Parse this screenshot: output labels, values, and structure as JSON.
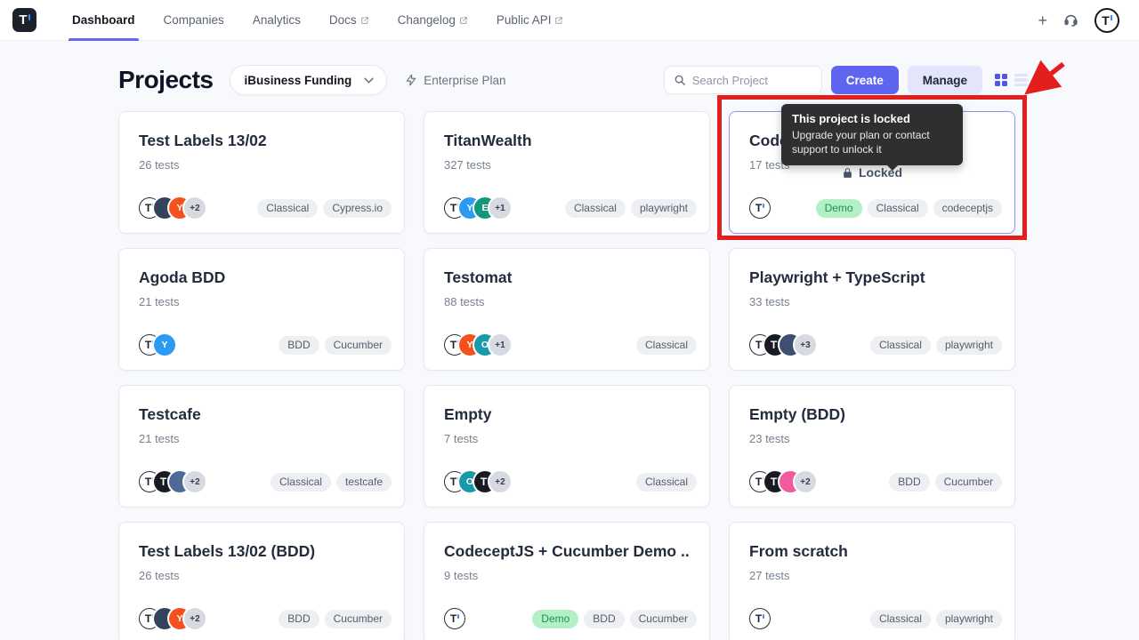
{
  "nav": {
    "items": [
      {
        "label": "Dashboard",
        "active": true,
        "external": false
      },
      {
        "label": "Companies",
        "active": false,
        "external": false
      },
      {
        "label": "Analytics",
        "active": false,
        "external": false
      },
      {
        "label": "Docs",
        "active": false,
        "external": true
      },
      {
        "label": "Changelog",
        "active": false,
        "external": true
      },
      {
        "label": "Public API",
        "active": false,
        "external": true
      }
    ],
    "plus_label": "+"
  },
  "header": {
    "title": "Projects",
    "company_selector": "iBusiness Funding",
    "plan": "Enterprise Plan",
    "search_placeholder": "Search Project",
    "create_label": "Create",
    "manage_label": "Manage"
  },
  "tooltip": {
    "title": "This project is locked",
    "body": "Upgrade your plan or contact support to unlock it"
  },
  "locked_label": "Locked",
  "colors": {
    "accent": "#6065f0",
    "locked_border": "#8b93f8",
    "annotation_red": "#e41d1d",
    "demo_tag_bg": "#b4f0c5",
    "demo_tag_text": "#1d9150"
  },
  "projects": [
    {
      "name": "Test Labels 13/02",
      "tests": "26 tests",
      "locked": false,
      "avatars": [
        {
          "type": "logo"
        },
        {
          "type": "img",
          "color": "#35425e"
        },
        {
          "type": "letter",
          "letter": "Y",
          "color": "#f4511e"
        }
      ],
      "more": "+2",
      "tags": [
        {
          "label": "Classical",
          "style": "gray"
        },
        {
          "label": "Cypress.io",
          "style": "gray"
        }
      ]
    },
    {
      "name": "TitanWealth",
      "tests": "327 tests",
      "locked": false,
      "avatars": [
        {
          "type": "logo"
        },
        {
          "type": "letter",
          "letter": "Y",
          "color": "#2b9af3"
        },
        {
          "type": "letter",
          "letter": "E",
          "color": "#12967d"
        }
      ],
      "more": "+1",
      "tags": [
        {
          "label": "Classical",
          "style": "gray"
        },
        {
          "label": "playwright",
          "style": "gray"
        }
      ]
    },
    {
      "name": "Code",
      "tests": "17 tests",
      "locked": true,
      "avatars": [
        {
          "type": "logo"
        }
      ],
      "more": null,
      "tags": [
        {
          "label": "Demo",
          "style": "green"
        },
        {
          "label": "Classical",
          "style": "gray"
        },
        {
          "label": "codeceptjs",
          "style": "gray"
        }
      ]
    },
    {
      "name": "Agoda BDD",
      "tests": "21 tests",
      "locked": false,
      "avatars": [
        {
          "type": "logo"
        },
        {
          "type": "letter",
          "letter": "Y",
          "color": "#2b9af3"
        }
      ],
      "more": null,
      "tags": [
        {
          "label": "BDD",
          "style": "gray"
        },
        {
          "label": "Cucumber",
          "style": "gray"
        }
      ]
    },
    {
      "name": "Testomat",
      "tests": "88 tests",
      "locked": false,
      "avatars": [
        {
          "type": "logo"
        },
        {
          "type": "letter",
          "letter": "Y",
          "color": "#f4511e"
        },
        {
          "type": "letter",
          "letter": "O",
          "color": "#1a9aa8"
        }
      ],
      "more": "+1",
      "tags": [
        {
          "label": "Classical",
          "style": "gray"
        }
      ]
    },
    {
      "name": "Playwright + TypeScript",
      "tests": "33 tests",
      "locked": false,
      "avatars": [
        {
          "type": "logo"
        },
        {
          "type": "dark"
        },
        {
          "type": "img",
          "color": "#3e4f73"
        }
      ],
      "more": "+3",
      "tags": [
        {
          "label": "Classical",
          "style": "gray"
        },
        {
          "label": "playwright",
          "style": "gray"
        }
      ]
    },
    {
      "name": "Testcafe",
      "tests": "21 tests",
      "locked": false,
      "avatars": [
        {
          "type": "logo"
        },
        {
          "type": "dark"
        },
        {
          "type": "img",
          "color": "#4e6a96"
        }
      ],
      "more": "+2",
      "tags": [
        {
          "label": "Classical",
          "style": "gray"
        },
        {
          "label": "testcafe",
          "style": "gray"
        }
      ]
    },
    {
      "name": "Empty",
      "tests": "7 tests",
      "locked": false,
      "avatars": [
        {
          "type": "logo"
        },
        {
          "type": "letter",
          "letter": "O",
          "color": "#1a9aa8"
        },
        {
          "type": "dark"
        }
      ],
      "more": "+2",
      "tags": [
        {
          "label": "Classical",
          "style": "gray"
        }
      ]
    },
    {
      "name": "Empty (BDD)",
      "tests": "23 tests",
      "locked": false,
      "avatars": [
        {
          "type": "logo"
        },
        {
          "type": "dark"
        },
        {
          "type": "img",
          "color": "#ef5b9c"
        }
      ],
      "more": "+2",
      "tags": [
        {
          "label": "BDD",
          "style": "gray"
        },
        {
          "label": "Cucumber",
          "style": "gray"
        }
      ]
    },
    {
      "name": "Test Labels 13/02 (BDD)",
      "tests": "26 tests",
      "locked": false,
      "avatars": [
        {
          "type": "logo"
        },
        {
          "type": "img",
          "color": "#35425e"
        },
        {
          "type": "letter",
          "letter": "Y",
          "color": "#f4511e"
        }
      ],
      "more": "+2",
      "tags": [
        {
          "label": "BDD",
          "style": "gray"
        },
        {
          "label": "Cucumber",
          "style": "gray"
        }
      ]
    },
    {
      "name": "CodeceptJS + Cucumber Demo ...",
      "tests": "9 tests",
      "locked": false,
      "avatars": [
        {
          "type": "logo"
        }
      ],
      "more": null,
      "tags": [
        {
          "label": "Demo",
          "style": "green"
        },
        {
          "label": "BDD",
          "style": "gray"
        },
        {
          "label": "Cucumber",
          "style": "gray"
        }
      ]
    },
    {
      "name": "From scratch",
      "tests": "27 tests",
      "locked": false,
      "avatars": [
        {
          "type": "logo"
        }
      ],
      "more": null,
      "tags": [
        {
          "label": "Classical",
          "style": "gray"
        },
        {
          "label": "playwright",
          "style": "gray"
        }
      ]
    }
  ]
}
